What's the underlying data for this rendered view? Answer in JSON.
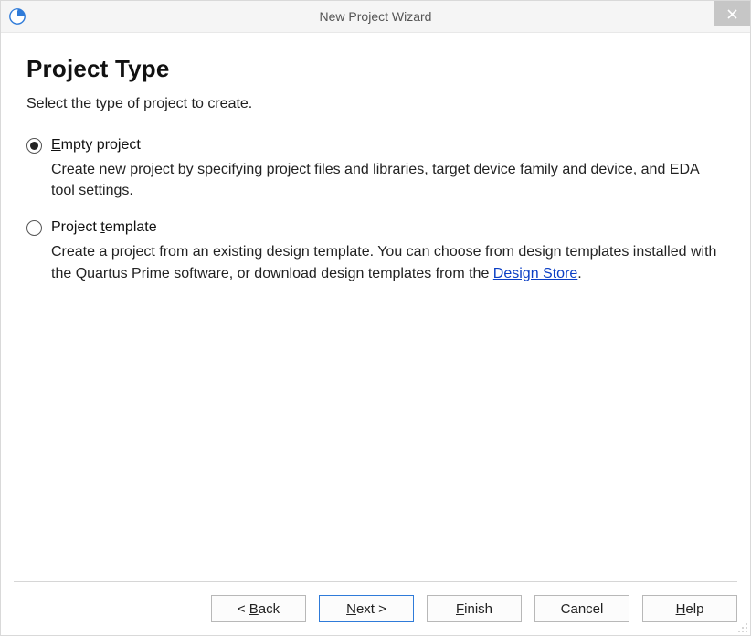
{
  "titlebar": {
    "title": "New Project Wizard"
  },
  "page": {
    "heading": "Project Type",
    "subtitle": "Select the type of project to create."
  },
  "options": {
    "empty": {
      "label_pre": "E",
      "label_post": "mpty project",
      "selected": true,
      "desc": "Create new project by specifying project files and libraries, target device family and device, and EDA tool settings."
    },
    "template": {
      "label_pre": "Project ",
      "label_u": "t",
      "label_post": "emplate",
      "selected": false,
      "desc_pre": "Create a project from an existing design template. You can choose from design templates installed with the Quartus Prime software, or download design templates from the ",
      "link": "Design Store",
      "desc_post": "."
    }
  },
  "buttons": {
    "back_pre": "< ",
    "back_u": "B",
    "back_post": "ack",
    "next_u": "N",
    "next_post": "ext >",
    "finish_u": "F",
    "finish_post": "inish",
    "cancel": "Cancel",
    "help_u": "H",
    "help_post": "elp"
  }
}
